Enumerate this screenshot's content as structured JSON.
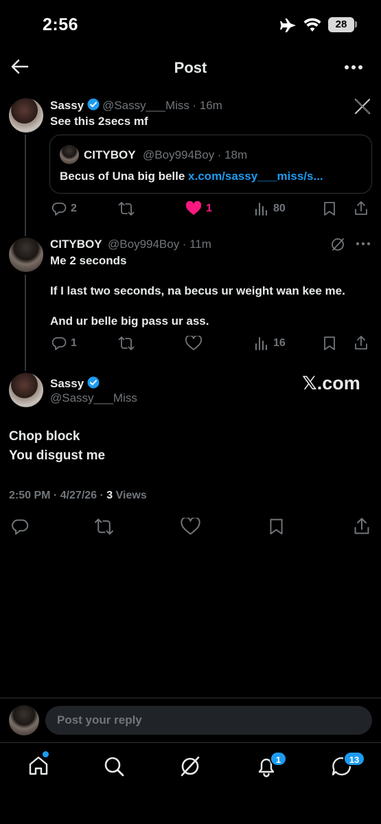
{
  "status_bar": {
    "time": "2:56",
    "battery": "28"
  },
  "header": {
    "title": "Post"
  },
  "post1": {
    "name": "Sassy",
    "handle": "@Sassy___Miss",
    "time": "· 16m",
    "text": "See this 2secs mf",
    "quote": {
      "name": "CITYBOY",
      "handle": "@Boy994Boy",
      "time": "· 18m",
      "text": "Becus of Una big belle",
      "link": "x.com/sassy___miss/s..."
    },
    "actions": {
      "replies": "2",
      "likes": "1",
      "views": "80"
    }
  },
  "post2": {
    "name": "CITYBOY",
    "handle": "@Boy994Boy",
    "time": "· 11m",
    "line1": "Me 2 seconds",
    "line2": "If I last two seconds, na becus ur weight wan kee me.",
    "line3": "And ur belle big pass ur ass.",
    "actions": {
      "replies": "1",
      "views": "16"
    }
  },
  "main_post": {
    "name": "Sassy",
    "handle": "@Sassy___Miss",
    "source": "𝕏.com",
    "line1": "Chop block",
    "line2": "You disgust me",
    "timestamp": "2:50 PM · 4/27/26 · ",
    "views_count": "3",
    "views_label": " Views"
  },
  "reply_bar": {
    "placeholder": "Post your reply"
  },
  "bottom_nav": {
    "notifications_badge": "1",
    "messages_badge": "13"
  },
  "colors": {
    "accent": "#1d9bf0",
    "like": "#f91880",
    "muted": "#71767b"
  }
}
